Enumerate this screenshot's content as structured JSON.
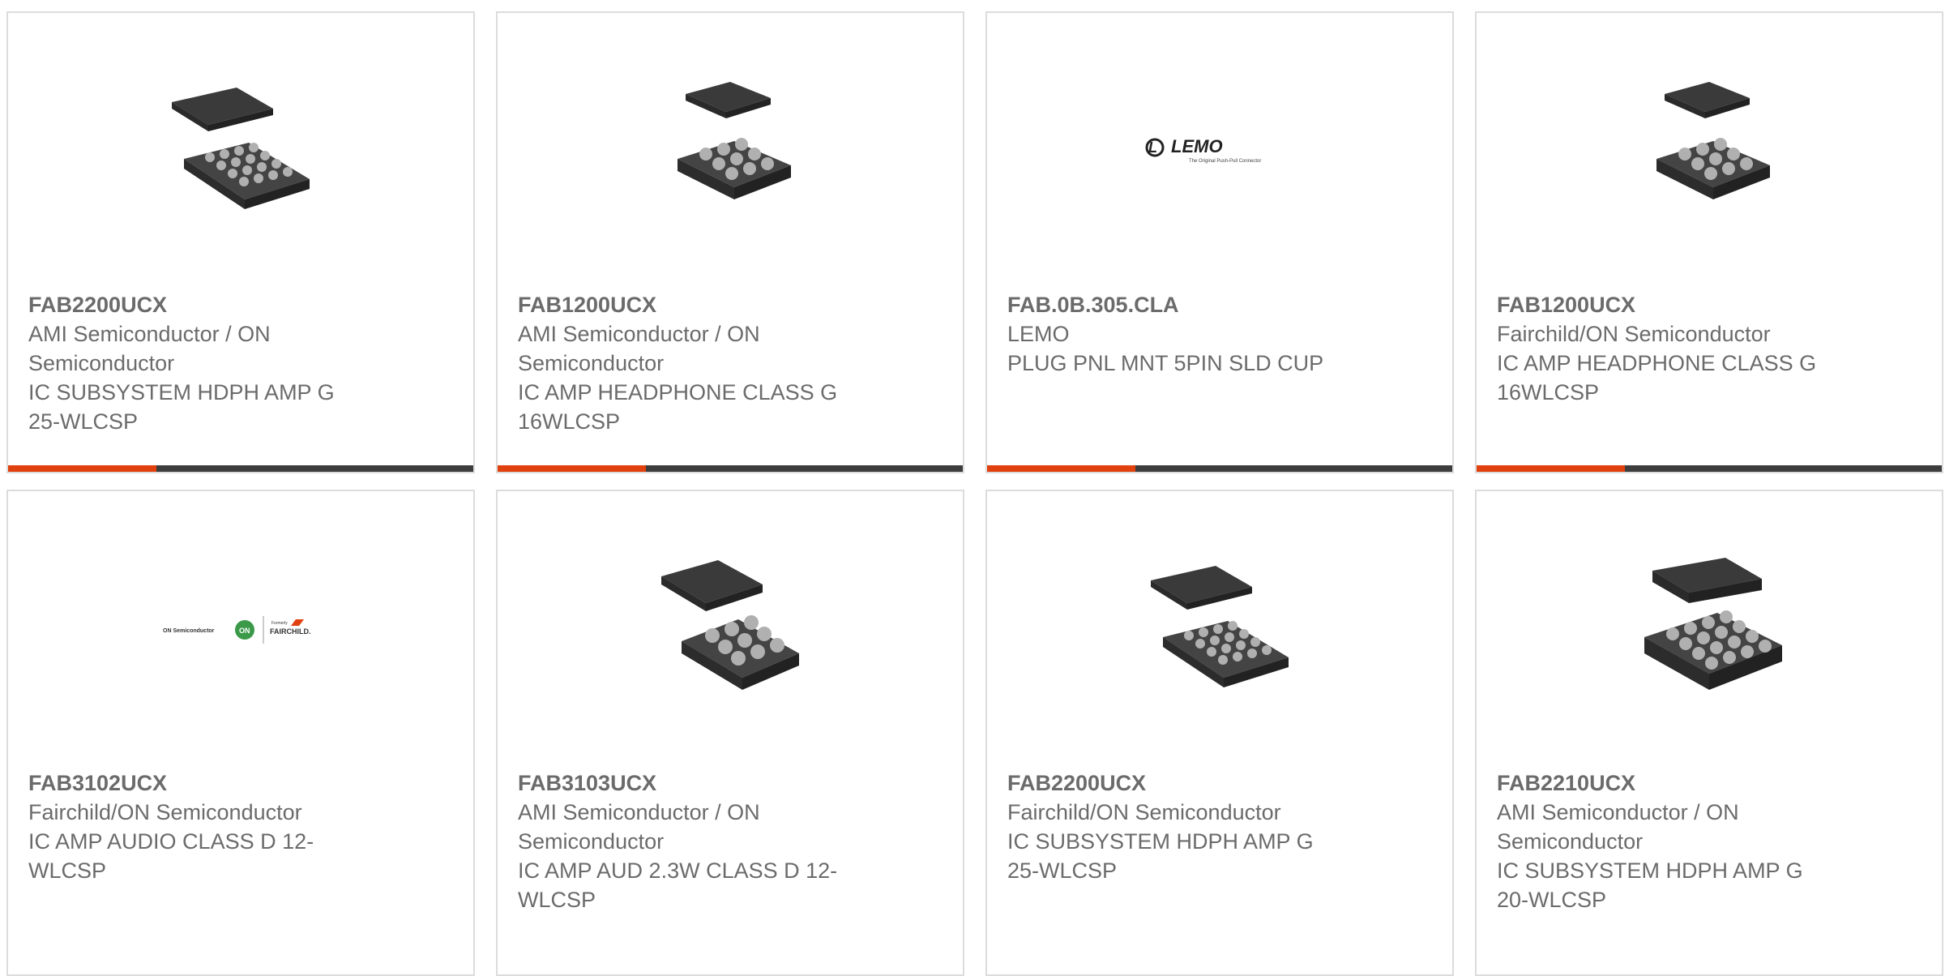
{
  "colors": {
    "accent": "#e1400f",
    "bar": "#3d3d3d",
    "border": "#dcdcdc",
    "text": "#6b6b6b"
  },
  "products": [
    {
      "part": "FAB2200UCX",
      "manufacturer": "AMI Semiconductor / ON Semiconductor",
      "description": "IC SUBSYSTEM HDPH AMP G 25-WLCSP",
      "image": "chip-25-ball-icon"
    },
    {
      "part": "FAB1200UCX",
      "manufacturer": "AMI Semiconductor / ON Semiconductor",
      "description": "IC AMP HEADPHONE CLASS G 16WLCSP",
      "image": "chip-16-ball-icon"
    },
    {
      "part": "FAB.0B.305.CLA",
      "manufacturer": "LEMO",
      "description": "PLUG PNL MNT 5PIN SLD CUP",
      "image": "lemo-logo",
      "logo_text": "LEMO",
      "logo_tagline": "The Original Push-Pull Connector"
    },
    {
      "part": "FAB1200UCX",
      "manufacturer": "Fairchild/ON Semiconductor",
      "description": "IC AMP HEADPHONE CLASS G 16WLCSP",
      "image": "chip-16-ball-icon"
    },
    {
      "part": "FAB3102UCX",
      "manufacturer": "Fairchild/ON Semiconductor",
      "description": "IC AMP AUDIO CLASS D 12-WLCSP",
      "image": "on-fairchild-logo",
      "logo_text": "ON Semiconductor",
      "logo_badge": "ON",
      "logo_formerly": "Formerly",
      "logo_brand": "FAIRCHILD."
    },
    {
      "part": "FAB3103UCX",
      "manufacturer": "AMI Semiconductor / ON Semiconductor",
      "description": "IC AMP AUD 2.3W CLASS D 12-WLCSP",
      "image": "chip-12-ball-icon"
    },
    {
      "part": "FAB2200UCX",
      "manufacturer": "Fairchild/ON Semiconductor",
      "description": "IC SUBSYSTEM HDPH AMP G 25-WLCSP",
      "image": "chip-25-ball-icon"
    },
    {
      "part": "FAB2210UCX",
      "manufacturer": "AMI Semiconductor / ON Semiconductor",
      "description": "IC SUBSYSTEM HDPH AMP G 20-WLCSP",
      "image": "chip-20-ball-icon"
    }
  ]
}
